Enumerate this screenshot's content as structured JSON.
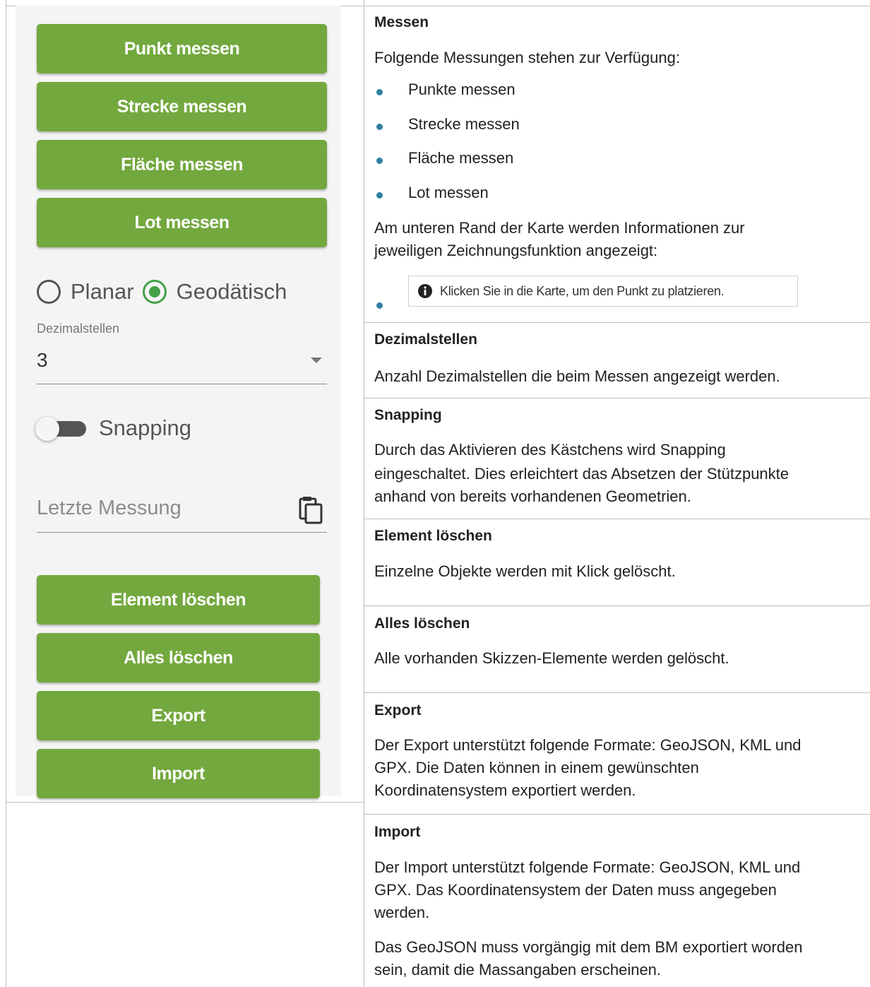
{
  "left_panel": {
    "measure_buttons": [
      "Punkt messen",
      "Strecke messen",
      "Fläche messen",
      "Lot messen"
    ],
    "mode": {
      "options": [
        {
          "label": "Planar",
          "selected": false
        },
        {
          "label": "Geodätisch",
          "selected": true
        }
      ]
    },
    "decimals": {
      "label": "Dezimalstellen",
      "value": "3"
    },
    "snapping": {
      "label": "Snapping",
      "enabled": false
    },
    "last_measurement": {
      "placeholder": "Letzte Messung",
      "icon": "clipboard-copy-icon"
    },
    "action_buttons": [
      "Element löschen",
      "Alles löschen",
      "Export",
      "Import"
    ],
    "colors": {
      "button_green": "#73a83e",
      "radio_green": "#43a047",
      "bullet_blue": "#2e7fa1"
    }
  },
  "right_panel": {
    "messen": {
      "title": "Messen",
      "intro": "Folgende Messungen stehen zur Verfügung:",
      "bullets": [
        "Punkte messen",
        "Strecke messen",
        "Fläche messen",
        "Lot messen"
      ],
      "info_text_1": "Am unteren Rand der Karte werden Informationen zur",
      "info_text_2": "jeweiligen Zeichnungsfunktion angezeigt:",
      "hint": "Klicken Sie in die Karte, um den Punkt zu platzieren."
    },
    "dezimalstellen": {
      "title": "Dezimalstellen",
      "text": "Anzahl Dezimalstellen die beim Messen angezeigt werden."
    },
    "snapping": {
      "title": "Snapping",
      "lines": [
        "Durch das Aktivieren des Kästchens wird Snapping",
        "eingeschaltet. Dies erleichtert das Absetzen der Stützpunkte",
        "anhand von bereits vorhandenen Geometrien."
      ]
    },
    "element_loeschen": {
      "title": "Element löschen",
      "text": "Einzelne Objekte werden mit Klick gelöscht."
    },
    "alles_loeschen": {
      "title": "Alles löschen",
      "text": "Alle vorhanden Skizzen-Elemente werden gelöscht."
    },
    "export": {
      "title": "Export",
      "lines": [
        "Der Export unterstützt folgende Formate: GeoJSON, KML und",
        "GPX. Die Daten können in einem gewünschten",
        "Koordinatensystem exportiert werden."
      ]
    },
    "import": {
      "title": "Import",
      "lines": [
        "Der Import unterstützt folgende Formate: GeoJSON, KML und",
        "GPX. Das Koordinatensystem der Daten muss angegeben",
        "werden."
      ],
      "note_lines": [
        "Das GeoJSON muss vorgängig mit dem BM exportiert worden",
        "sein, damit die Massangaben erscheinen."
      ]
    }
  }
}
